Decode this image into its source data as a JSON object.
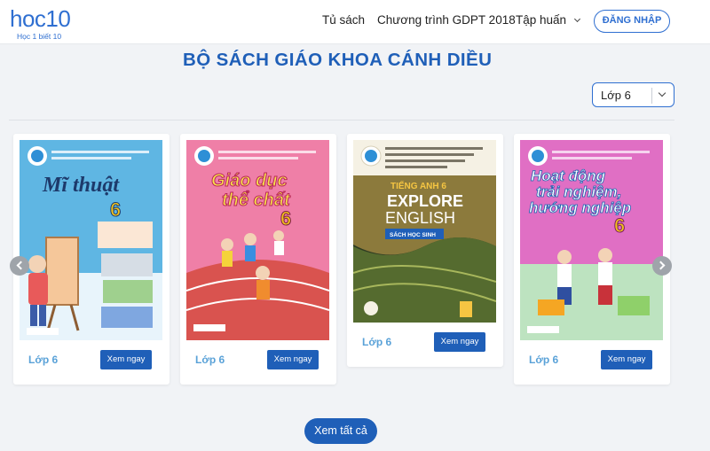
{
  "header": {
    "logo": {
      "main": "hoc10",
      "sub": "Học 1 biết 10"
    },
    "nav": [
      {
        "label": "Tủ sách"
      },
      {
        "label": "Chương trình GDPT 2018"
      },
      {
        "label": "Tập huấn"
      }
    ],
    "login_label": "ĐĂNG NHẬP"
  },
  "section": {
    "title": "BỘ SÁCH GIÁO KHOA CÁNH DIỀU",
    "grade_select": {
      "value": "Lớp 6"
    }
  },
  "books": [
    {
      "cover_title": "Mĩ thuật",
      "cover_number": "6",
      "grade": "Lớp 6",
      "button": "Xem ngay",
      "cover_color": "#5fb6e3"
    },
    {
      "cover_title_1": "Giáo dục",
      "cover_title_2": "thể chất",
      "cover_number": "6",
      "grade": "Lớp 6",
      "button": "Xem ngay",
      "cover_color": "#ef7fa7"
    },
    {
      "cover_top": "TIẾNG ANH 6",
      "cover_title_1": "EXPLORE",
      "cover_title_2": "ENGLISH",
      "cover_sub": "SÁCH HỌC SINH",
      "grade": "Lớp 6",
      "button": "Xem ngay",
      "cover_color": "#2d3a22"
    },
    {
      "cover_title_1": "Hoạt động",
      "cover_title_2": "trải nghiệm,",
      "cover_title_3": "hướng nghiệp",
      "cover_number": "6",
      "grade": "Lớp 6",
      "button": "Xem ngay",
      "cover_color": "#e06fc4"
    }
  ],
  "icons": {
    "prev": "chevron-left-icon",
    "next": "chevron-right-icon"
  },
  "view_all_label": "Xem tất cả"
}
